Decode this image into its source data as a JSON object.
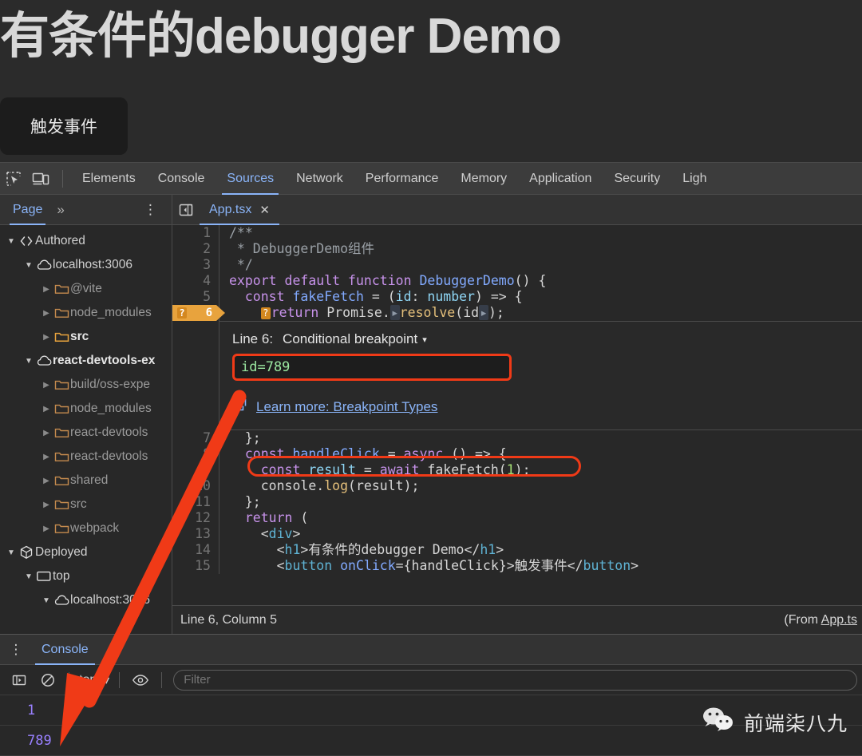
{
  "page": {
    "title": "有条件的debugger Demo",
    "trigger_button": "触发事件"
  },
  "devtools": {
    "inspect_icon": "inspect-element-icon",
    "device_icon": "device-toolbar-icon",
    "tabs": [
      {
        "label": "Elements",
        "active": false
      },
      {
        "label": "Console",
        "active": false
      },
      {
        "label": "Sources",
        "active": true
      },
      {
        "label": "Network",
        "active": false
      },
      {
        "label": "Performance",
        "active": false
      },
      {
        "label": "Memory",
        "active": false
      },
      {
        "label": "Application",
        "active": false
      },
      {
        "label": "Security",
        "active": false
      },
      {
        "label": "Ligh",
        "active": false
      }
    ]
  },
  "navigator": {
    "tab": "Page",
    "more": "»",
    "kebab": "⋮",
    "tree": [
      {
        "label": "Authored",
        "indent": 0,
        "icon": "code-brackets-icon",
        "expanded": true,
        "dim": false,
        "bold": false
      },
      {
        "label": "localhost:3006",
        "indent": 1,
        "icon": "cloud-icon",
        "expanded": true,
        "dim": false,
        "bold": false
      },
      {
        "label": "@vite",
        "indent": 2,
        "icon": "folder-icon",
        "expanded": false,
        "dim": true,
        "bold": false
      },
      {
        "label": "node_modules",
        "indent": 2,
        "icon": "folder-icon",
        "expanded": false,
        "dim": true,
        "bold": false
      },
      {
        "label": "src",
        "indent": 2,
        "icon": "folder-open-icon",
        "expanded": false,
        "dim": false,
        "bold": true
      },
      {
        "label": "react-devtools-ex",
        "indent": 1,
        "icon": "cloud-icon",
        "expanded": true,
        "dim": false,
        "bold": true
      },
      {
        "label": "build/oss-expe",
        "indent": 2,
        "icon": "folder-icon",
        "expanded": false,
        "dim": true,
        "bold": false
      },
      {
        "label": "node_modules",
        "indent": 2,
        "icon": "folder-icon",
        "expanded": false,
        "dim": true,
        "bold": false
      },
      {
        "label": "react-devtools",
        "indent": 2,
        "icon": "folder-icon",
        "expanded": false,
        "dim": true,
        "bold": false
      },
      {
        "label": "react-devtools",
        "indent": 2,
        "icon": "folder-icon",
        "expanded": false,
        "dim": true,
        "bold": false
      },
      {
        "label": "shared",
        "indent": 2,
        "icon": "folder-icon",
        "expanded": false,
        "dim": true,
        "bold": false
      },
      {
        "label": "src",
        "indent": 2,
        "icon": "folder-icon",
        "expanded": false,
        "dim": true,
        "bold": false
      },
      {
        "label": "webpack",
        "indent": 2,
        "icon": "folder-icon",
        "expanded": false,
        "dim": true,
        "bold": false
      },
      {
        "label": "Deployed",
        "indent": 0,
        "icon": "cube-icon",
        "expanded": true,
        "dim": false,
        "bold": false
      },
      {
        "label": "top",
        "indent": 1,
        "icon": "frame-icon",
        "expanded": true,
        "dim": false,
        "bold": false
      },
      {
        "label": "localhost:3006",
        "indent": 2,
        "icon": "cloud-icon",
        "expanded": true,
        "dim": false,
        "bold": false
      }
    ]
  },
  "editor": {
    "file_tab": "App.tsx",
    "close_label": "✕",
    "panel_toggle_icon": "collapse-navigator-icon",
    "lines_top": [
      "1",
      "2",
      "3",
      "4",
      "5",
      "6"
    ],
    "lines_bottom": [
      "7",
      "8",
      "9",
      "10",
      "11",
      "12",
      "13",
      "14",
      "15"
    ],
    "breakpoint_line": "6",
    "breakpoint_marker": "?",
    "status_position": "Line 6, Column 5",
    "status_from_prefix": "(From ",
    "status_from_link": "App.ts"
  },
  "breakpoint_dialog": {
    "line_label": "Line 6:",
    "type_label": "Conditional breakpoint",
    "caret": "▾",
    "condition_value": "id=789",
    "learn_more": "Learn more: Breakpoint Types",
    "external_icon": "external-link-icon"
  },
  "drawer": {
    "kebab": "⋮",
    "tab": "Console",
    "toolbar": {
      "sidebar_icon": "console-sidebar-icon",
      "clear_icon": "clear-console-icon",
      "context_label": "top",
      "context_caret": "▾",
      "eye_icon": "live-expression-eye-icon",
      "filter_placeholder": "Filter"
    },
    "messages": [
      "1",
      "789"
    ]
  },
  "watermark": {
    "icon": "wechat-icon",
    "text": "前端柒八九"
  },
  "code": {
    "top": [
      [
        {
          "t": "/**",
          "c": "tok-com"
        }
      ],
      [
        {
          "t": " * DebuggerDemo组件",
          "c": "tok-com"
        }
      ],
      [
        {
          "t": " */",
          "c": "tok-com"
        }
      ],
      [
        {
          "t": "export",
          "c": "tok-kw"
        },
        {
          "t": " ",
          "c": "tok-pl"
        },
        {
          "t": "default",
          "c": "tok-kw"
        },
        {
          "t": " ",
          "c": "tok-pl"
        },
        {
          "t": "function",
          "c": "tok-kw"
        },
        {
          "t": " ",
          "c": "tok-pl"
        },
        {
          "t": "DebuggerDemo",
          "c": "tok-fn"
        },
        {
          "t": "() {",
          "c": "tok-pl"
        }
      ],
      [
        {
          "t": "  ",
          "c": "tok-pl"
        },
        {
          "t": "const",
          "c": "tok-kw"
        },
        {
          "t": " ",
          "c": "tok-pl"
        },
        {
          "t": "fakeFetch",
          "c": "tok-fn"
        },
        {
          "t": " = (",
          "c": "tok-pl"
        },
        {
          "t": "id",
          "c": "tok-var"
        },
        {
          "t": ": ",
          "c": "tok-pl"
        },
        {
          "t": "number",
          "c": "tok-var"
        },
        {
          "t": ") => {",
          "c": "tok-pl"
        }
      ],
      [
        {
          "t": "    ",
          "c": "tok-pl"
        },
        {
          "t": "__QMARK__",
          "c": "marker"
        },
        {
          "t": "return",
          "c": "tok-kw"
        },
        {
          "t": " Promise.",
          "c": "tok-pl"
        },
        {
          "t": "__SCOPE__",
          "c": "scope"
        },
        {
          "t": "resolve",
          "c": "tok-yel"
        },
        {
          "t": "(",
          "c": "tok-pl"
        },
        {
          "t": "id",
          "c": "tok-pl"
        },
        {
          "t": "__SCOPE2__",
          "c": "scope"
        },
        {
          "t": ");",
          "c": "tok-pl"
        }
      ]
    ],
    "bottom": [
      [
        {
          "t": "  };",
          "c": "tok-pl"
        }
      ],
      [
        {
          "t": "  ",
          "c": "tok-pl"
        },
        {
          "t": "const",
          "c": "tok-kw"
        },
        {
          "t": " ",
          "c": "tok-pl"
        },
        {
          "t": "handleClick",
          "c": "tok-fn"
        },
        {
          "t": " = ",
          "c": "tok-pl"
        },
        {
          "t": "async",
          "c": "tok-kw"
        },
        {
          "t": " () => {",
          "c": "tok-pl"
        }
      ],
      [
        {
          "t": "    ",
          "c": "tok-pl"
        },
        {
          "t": "const",
          "c": "tok-kw"
        },
        {
          "t": " ",
          "c": "tok-pl"
        },
        {
          "t": "result",
          "c": "tok-var"
        },
        {
          "t": " = ",
          "c": "tok-pl"
        },
        {
          "t": "await",
          "c": "tok-kw"
        },
        {
          "t": " fakeFetch(",
          "c": "tok-pl"
        },
        {
          "t": "1",
          "c": "tok-num"
        },
        {
          "t": ");",
          "c": "tok-pl"
        }
      ],
      [
        {
          "t": "    console.",
          "c": "tok-pl"
        },
        {
          "t": "log",
          "c": "tok-yel"
        },
        {
          "t": "(result);",
          "c": "tok-pl"
        }
      ],
      [
        {
          "t": "  };",
          "c": "tok-pl"
        }
      ],
      [
        {
          "t": "  ",
          "c": "tok-pl"
        },
        {
          "t": "return",
          "c": "tok-kw"
        },
        {
          "t": " (",
          "c": "tok-pl"
        }
      ],
      [
        {
          "t": "    <",
          "c": "tok-pl"
        },
        {
          "t": "div",
          "c": "tok-tag"
        },
        {
          "t": ">",
          "c": "tok-pl"
        }
      ],
      [
        {
          "t": "      <",
          "c": "tok-pl"
        },
        {
          "t": "h1",
          "c": "tok-tag"
        },
        {
          "t": ">有条件的debugger Demo</",
          "c": "tok-pl"
        },
        {
          "t": "h1",
          "c": "tok-tag"
        },
        {
          "t": ">",
          "c": "tok-pl"
        }
      ],
      [
        {
          "t": "      <",
          "c": "tok-pl"
        },
        {
          "t": "button",
          "c": "tok-tag"
        },
        {
          "t": " ",
          "c": "tok-pl"
        },
        {
          "t": "onClick",
          "c": "tok-fn"
        },
        {
          "t": "={handleClick}>触发事件</",
          "c": "tok-pl"
        },
        {
          "t": "button",
          "c": "tok-tag"
        },
        {
          "t": ">",
          "c": "tok-pl"
        }
      ]
    ]
  },
  "colors": {
    "accent": "#8ab4f8",
    "annotation": "#f03a17",
    "breakpoint": "#e8a33d",
    "console_value": "#9980ff",
    "background": "#282828"
  }
}
